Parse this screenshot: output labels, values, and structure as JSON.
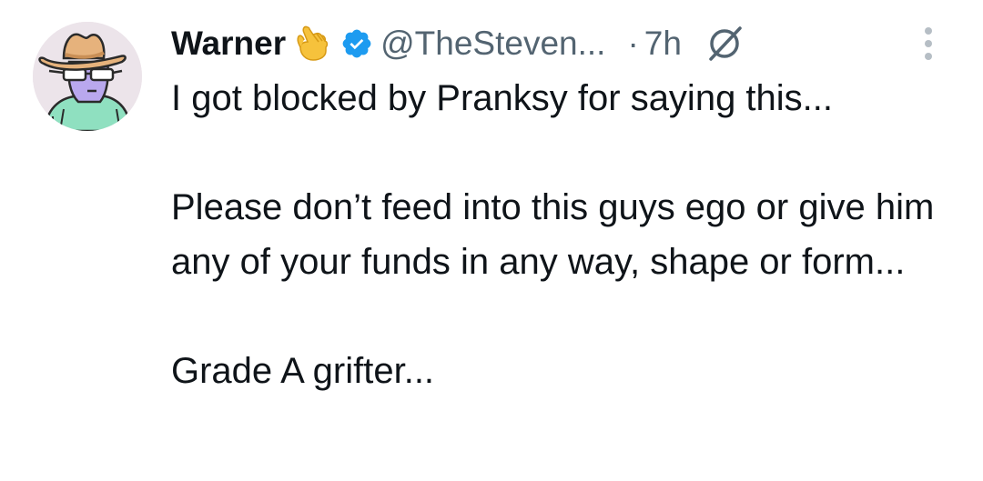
{
  "tweet": {
    "author_name": "Warner",
    "author_emoji": "call-me-hand-emoji",
    "verified_icon": "verified-badge-icon",
    "handle": "@TheSteven...",
    "separator": "·",
    "timestamp": "7h",
    "grok_icon": "grok-icon",
    "more_icon": "more-options-icon",
    "text": {
      "line1": "I got blocked by Pranksy for saying this...",
      "paragraph2": "Please don’t feed into this guys ego or give him any of your funds in any way, shape or form...",
      "paragraph3": "Grade A grifter..."
    }
  },
  "colors": {
    "text_primary": "#0f1419",
    "text_secondary": "#536471",
    "verified_blue": "#1d9bf0",
    "avatar_bg": "#ece4ea"
  }
}
